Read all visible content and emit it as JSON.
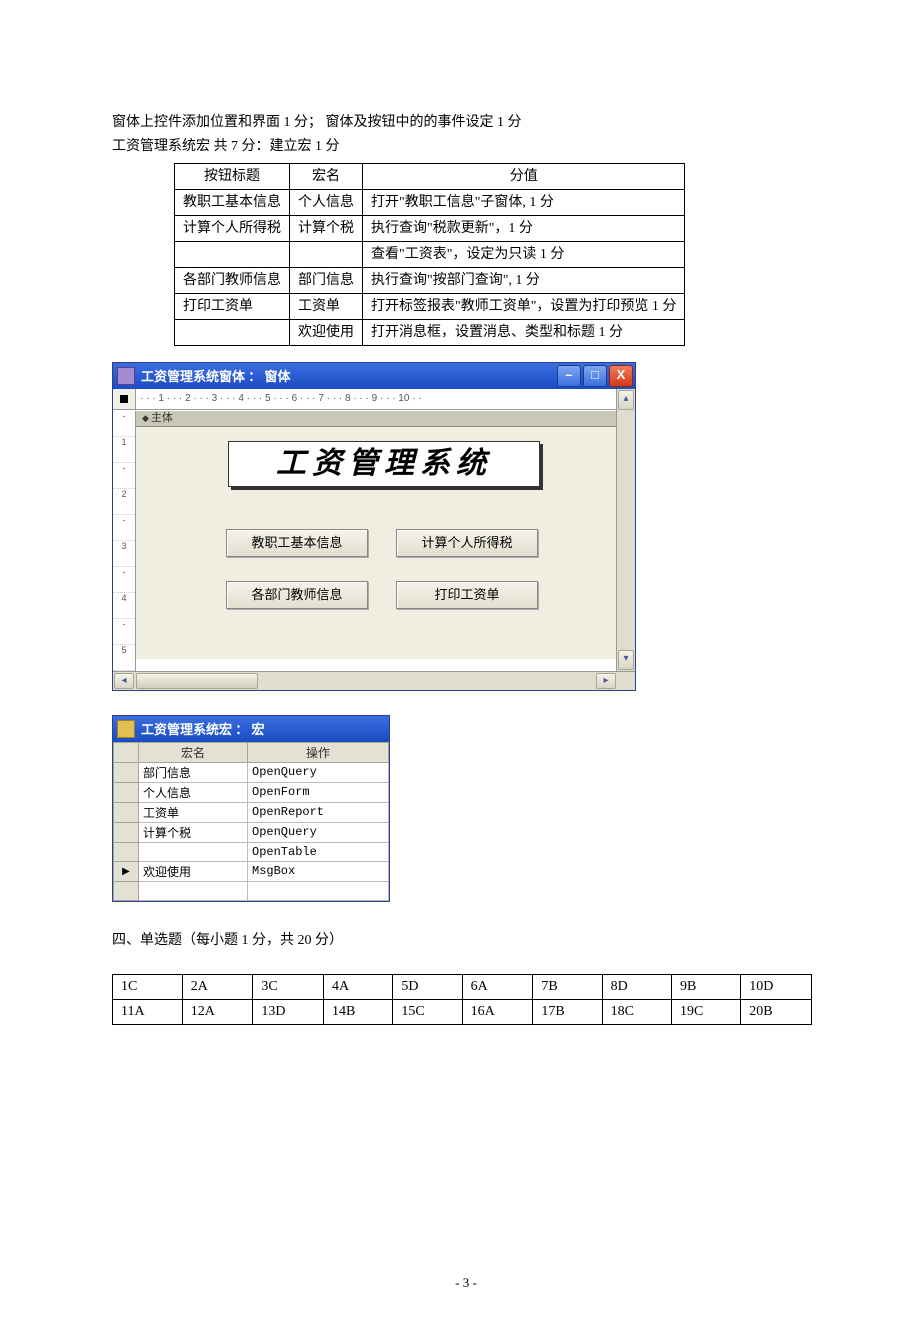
{
  "intro": {
    "line1": "窗体上控件添加位置和界面  1 分；  窗体及按钮中的的事件设定 1 分",
    "line2": "工资管理系统宏 共 7 分：建立宏 1 分"
  },
  "score_table": {
    "head": {
      "c1": "按钮标题",
      "c2": "宏名",
      "c3": "分值"
    },
    "rows": [
      {
        "c1": "教职工基本信息",
        "c2": "个人信息",
        "c3": "打开\"教职工信息\"子窗体, 1 分"
      },
      {
        "c1": "计算个人所得税",
        "c2": "计算个税",
        "c3": "执行查询\"税款更新\"，1 分"
      },
      {
        "c1": "",
        "c2": "",
        "c3": "查看\"工资表\"，设定为只读 1 分"
      },
      {
        "c1": "各部门教师信息",
        "c2": "部门信息",
        "c3": "执行查询\"按部门查询\", 1 分"
      },
      {
        "c1": "打印工资单",
        "c2": "工资单",
        "c3": "打开标签报表\"教师工资单\"，设置为打印预览 1 分"
      },
      {
        "c1": "",
        "c2": "欢迎使用",
        "c3": "打开消息框，设置消息、类型和标题  1 分"
      }
    ]
  },
  "form_window": {
    "title": "工资管理系统窗体 ： 窗体",
    "hruler": "· · · 1 · · · 2 · · · 3 · · · 4 · · · 5 · · · 6 · · · 7 · · · 8 · · · 9 · · · 10 · ·",
    "section": "主体",
    "big_title": "工资管理系统",
    "buttons": {
      "b1": "教职工基本信息",
      "b2": "计算个人所得税",
      "b3": "各部门教师信息",
      "b4": "打印工资单"
    },
    "vruler": [
      "-",
      "1",
      "-",
      "2",
      "-",
      "3",
      "-",
      "4",
      "-",
      "5"
    ]
  },
  "macro_window": {
    "title": "工资管理系统宏 ： 宏",
    "head": {
      "c1": "宏名",
      "c2": "操作"
    },
    "rows": [
      {
        "sel": "",
        "name": "部门信息",
        "op": "OpenQuery"
      },
      {
        "sel": "",
        "name": "个人信息",
        "op": "OpenForm"
      },
      {
        "sel": "",
        "name": "工资单",
        "op": "OpenReport"
      },
      {
        "sel": "",
        "name": "计算个税",
        "op": "OpenQuery"
      },
      {
        "sel": "",
        "name": "",
        "op": "OpenTable"
      },
      {
        "sel": "▶",
        "name": "欢迎使用",
        "op": "MsgBox"
      },
      {
        "sel": "",
        "name": "",
        "op": ""
      }
    ]
  },
  "section4_title": "四、单选题（每小题 1 分，共 20 分）",
  "answers": {
    "row1": [
      "1C",
      "2A",
      "3C",
      "4A",
      "5D",
      "6A",
      "7B",
      "8D",
      "9B",
      "10D"
    ],
    "row2": [
      "11A",
      "12A",
      "13D",
      "14B",
      "15C",
      "16A",
      "17B",
      "18C",
      "19C",
      "20B"
    ]
  },
  "page_number": "- 3 -",
  "glyphs": {
    "min": "–",
    "max": "□",
    "close": "X",
    "up": "▴",
    "dn": "▾",
    "lt": "◂",
    "rt": "▸"
  }
}
